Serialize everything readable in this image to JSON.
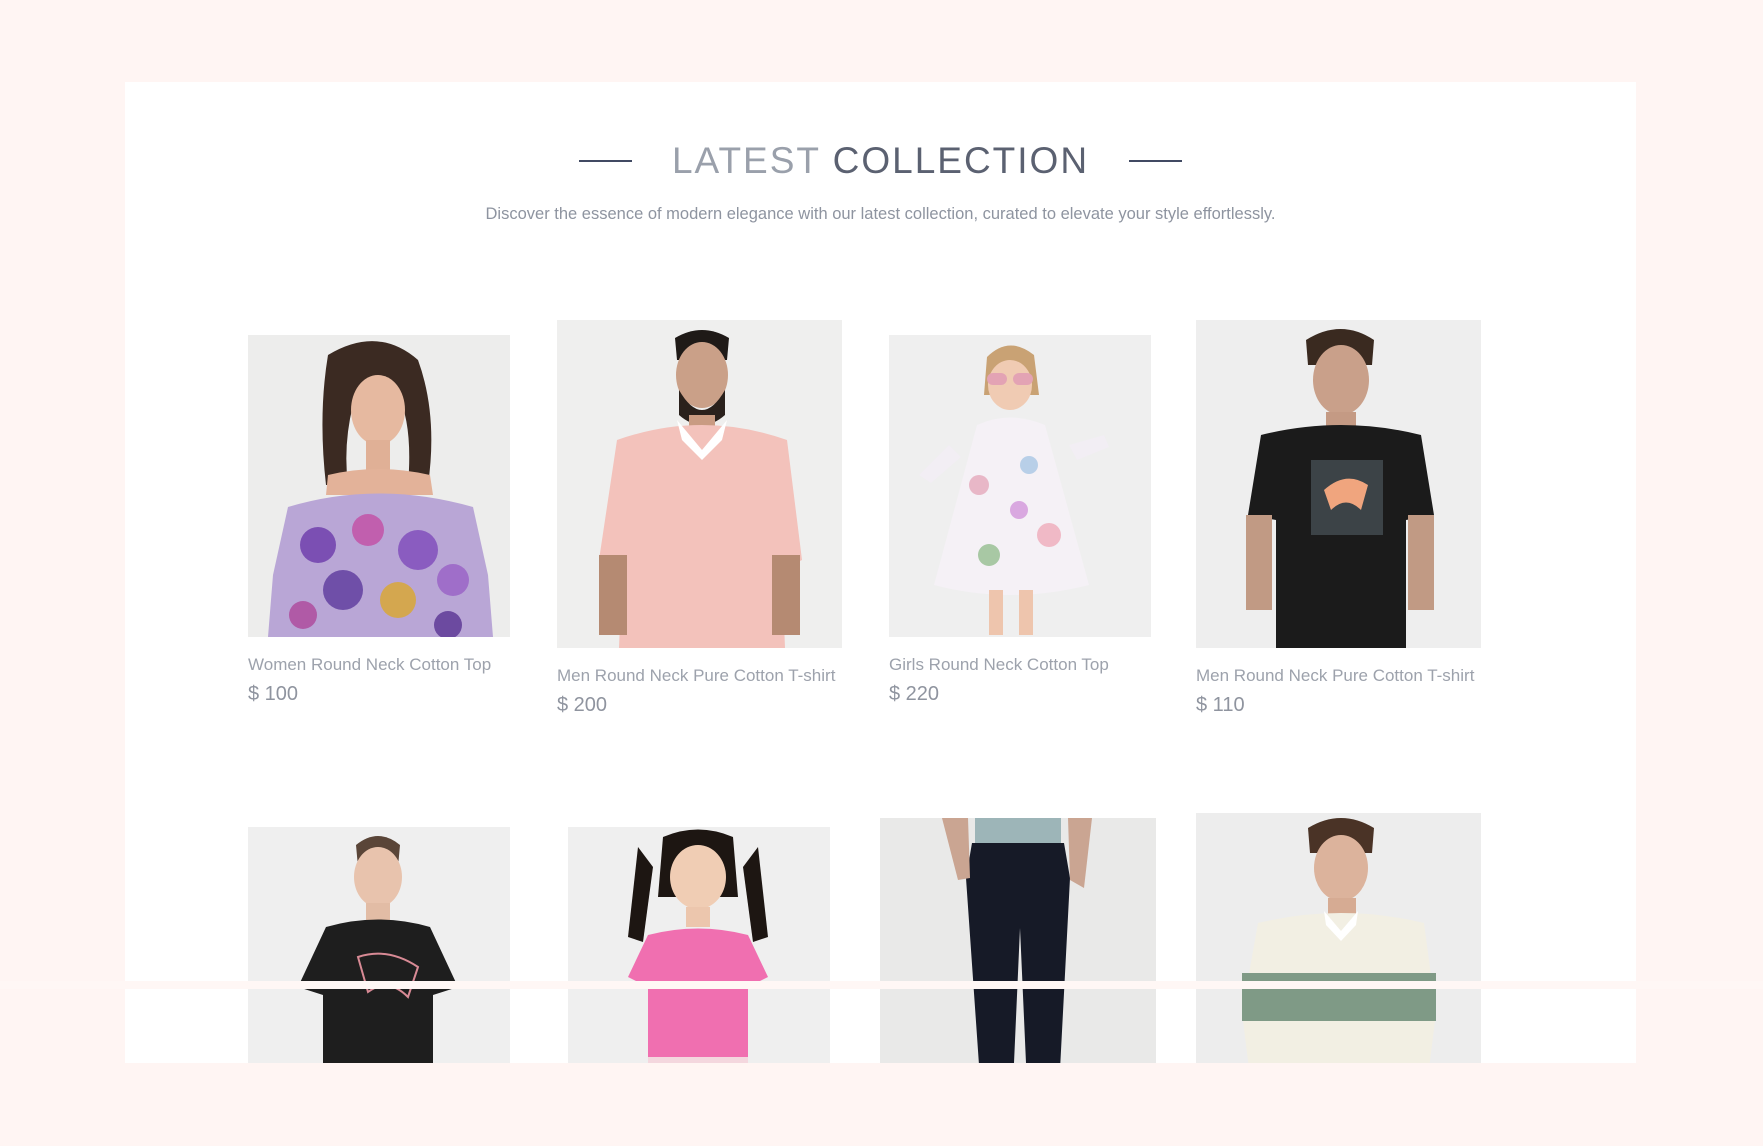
{
  "section": {
    "title_light": "LATEST",
    "title_dark": "COLLECTION",
    "subtitle": "Discover the essence of modern elegance with our latest collection, curated to elevate your style effortlessly."
  },
  "products": [
    {
      "name": "Women Round Neck Cotton Top",
      "price": "$ 100",
      "image": "woman-floral-off-shoulder-top"
    },
    {
      "name": "Men Round Neck Pure Cotton T-shirt",
      "price": "$ 200",
      "image": "man-pink-polo-shirt"
    },
    {
      "name": "Girls Round Neck Cotton Top",
      "price": "$ 220",
      "image": "girl-floral-dress-sunglasses"
    },
    {
      "name": "Men Round Neck Pure Cotton T-shirt",
      "price": "$ 110",
      "image": "man-black-puma-tshirt"
    },
    {
      "name": "",
      "price": "",
      "image": "woman-black-puma-tshirt"
    },
    {
      "name": "",
      "price": "",
      "image": "girl-pink-top"
    },
    {
      "name": "",
      "price": "",
      "image": "navy-jeans"
    },
    {
      "name": "",
      "price": "",
      "image": "man-cream-striped-rugby-shirt"
    }
  ],
  "colors": {
    "page_bg": "#fff5f3",
    "panel_bg": "#ffffff",
    "heading_accent": "#414a63"
  }
}
